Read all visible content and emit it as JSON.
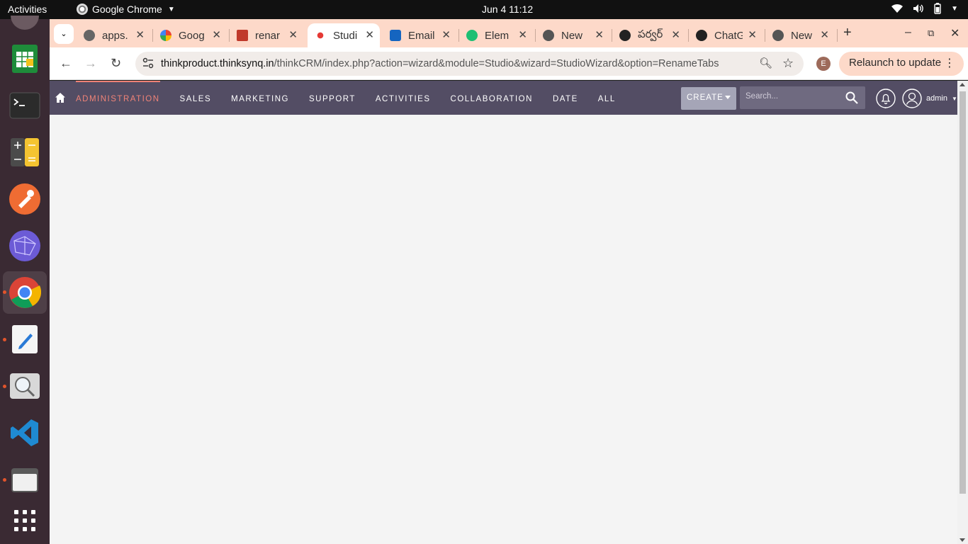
{
  "system_bar": {
    "activities": "Activities",
    "app_name": "Google Chrome",
    "clock": "Jun 4  11:12"
  },
  "dock": {
    "items": [
      {
        "name": "LibreOffice Calc",
        "icon": "spreadsheet-icon"
      },
      {
        "name": "Terminal",
        "icon": "terminal-icon"
      },
      {
        "name": "Calculator",
        "icon": "calculator-icon"
      },
      {
        "name": "Postman",
        "icon": "postman-icon"
      },
      {
        "name": "Network",
        "icon": "globe-network-icon"
      },
      {
        "name": "Google Chrome",
        "icon": "chrome-icon"
      },
      {
        "name": "Text Editor",
        "icon": "text-editor-icon"
      },
      {
        "name": "Image Viewer",
        "icon": "magnifier-icon"
      },
      {
        "name": "VS Code",
        "icon": "vscode-icon"
      },
      {
        "name": "Files",
        "icon": "files-icon"
      },
      {
        "name": "Show Applications",
        "icon": "app-grid-icon"
      }
    ]
  },
  "tabs": [
    {
      "title": "apps.",
      "icon": "globe-icon",
      "color": "#666666"
    },
    {
      "title": "Goog",
      "icon": "google-icon",
      "color": "#4285f4"
    },
    {
      "title": "renar",
      "icon": "quote-icon",
      "color": "#c0392b"
    },
    {
      "title": "Studi",
      "icon": "studio-icon",
      "color": "#e53935",
      "active": true
    },
    {
      "title": "Email",
      "icon": "outlook-icon",
      "color": "#1565c0"
    },
    {
      "title": "Elem",
      "icon": "element-icon",
      "color": "#1dbf73"
    },
    {
      "title": "New",
      "icon": "chrome-gray-icon",
      "color": "#555555"
    },
    {
      "title": "పర్వర్",
      "icon": "openai-icon",
      "color": "#222222"
    },
    {
      "title": "ChatG",
      "icon": "openai-icon",
      "color": "#222222"
    },
    {
      "title": "New",
      "icon": "chrome-gray-icon",
      "color": "#555555"
    }
  ],
  "toolbar": {
    "url_host": "thinkproduct.thinksynq.in",
    "url_path": "/thinkCRM/index.php?action=wizard&module=Studio&wizard=StudioWizard&option=RenameTabs",
    "profile_initial": "E",
    "relaunch_label": "Relaunch to update"
  },
  "crm_nav": {
    "menu": [
      "ADMINISTRATION",
      "SALES",
      "MARKETING",
      "SUPPORT",
      "ACTIVITIES",
      "COLLABORATION",
      "DATE",
      "ALL"
    ],
    "active_index": 0,
    "create_label": "CREATE",
    "search_placeholder": "Search...",
    "user_label": "admin"
  },
  "colors": {
    "nav_bg": "#534d64",
    "accent": "#f08377",
    "tabstrip_bg": "#fdd9c9"
  }
}
